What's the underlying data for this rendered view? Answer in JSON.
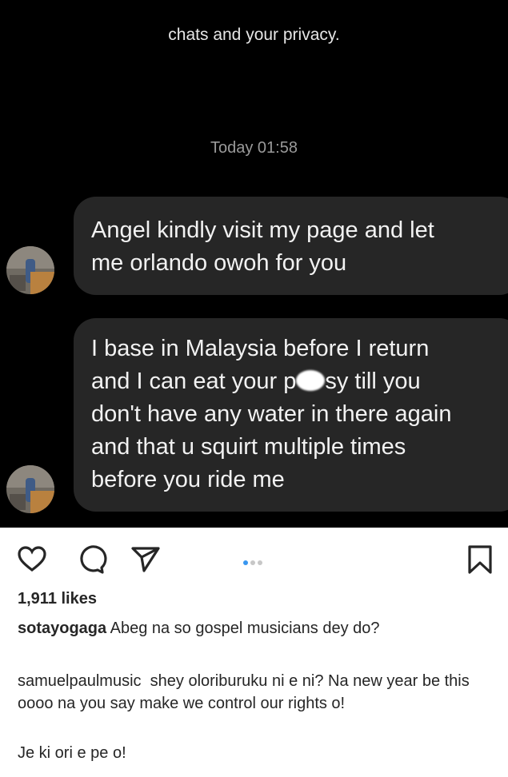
{
  "dm": {
    "notice": "chats and your privacy.",
    "timestamp": "Today 01:58",
    "messages": [
      {
        "lines": [
          "Angel kindly visit my page and let",
          "me orlando owoh for you"
        ]
      },
      {
        "lines": [
          "I base in Malaysia before I return",
          "and I can eat your p",
          "sy till you",
          "don't have any water in there again",
          "and that u squirt multiple times",
          "before you ride me"
        ]
      }
    ]
  },
  "post": {
    "likes": "1,911 likes",
    "carousel_dots": 3,
    "active_dot": 1,
    "captions": [
      {
        "user": "sotayogaga",
        "text": "Abeg na so gospel musicians dey do?"
      },
      {
        "user": "samuelpaulmusic",
        "text": "shey oloriburuku ni e ni? Na new year be this oooo na you say make we control our rights o!"
      },
      {
        "text": "Je ki ori e pe o!"
      }
    ],
    "icons": [
      "heart-icon",
      "comment-icon",
      "share-icon",
      "bookmark-icon"
    ]
  },
  "colors": {
    "bubble": "#262626",
    "background": "#000000",
    "dot_active": "#3897f0"
  }
}
